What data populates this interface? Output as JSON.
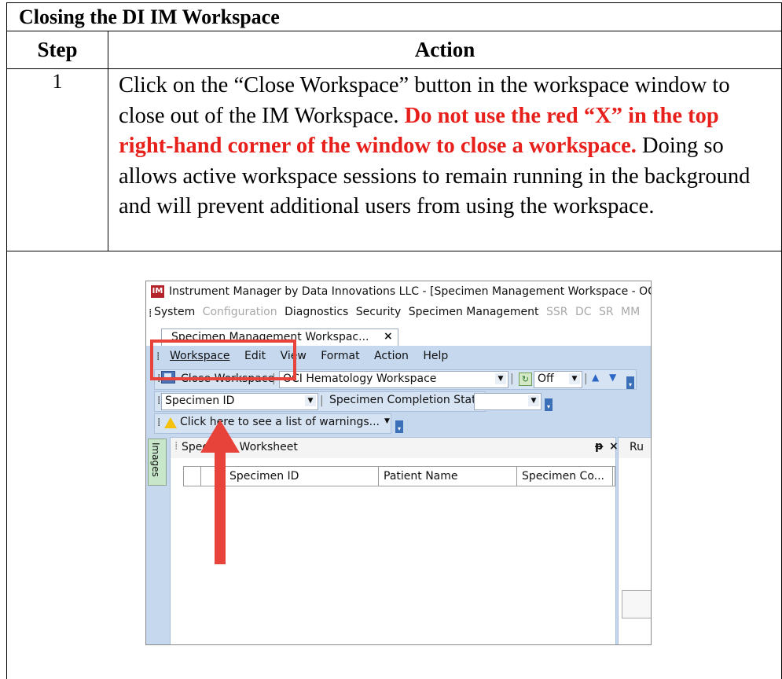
{
  "doc": {
    "title": "Closing the DI IM Workspace",
    "col_step": "Step",
    "col_action": "Action",
    "step_number": "1",
    "instruction_part1": "Click on the “Close Workspace” button in the workspace window to close out of the IM Workspace. ",
    "instruction_warning": "Do not use the red “X” in the top right-hand corner of the window to close a workspace.",
    "instruction_part2": " Doing so allows active workspace sessions to remain running in the background and will prevent additional users from using the workspace."
  },
  "app": {
    "logo": "IM",
    "window_title": "Instrument Manager by Data Innovations LLC - [Specimen Management Workspace - OCI",
    "menu_bar": [
      {
        "label": "System",
        "enabled": true
      },
      {
        "label": "Configuration",
        "enabled": false
      },
      {
        "label": "Diagnostics",
        "enabled": true
      },
      {
        "label": "Security",
        "enabled": true
      },
      {
        "label": "Specimen Management",
        "enabled": true
      },
      {
        "label": "SSR",
        "enabled": false
      },
      {
        "label": "DC",
        "enabled": false
      },
      {
        "label": "SR",
        "enabled": false
      },
      {
        "label": "MM",
        "enabled": false
      }
    ],
    "tab_label": "Specimen Management Workspac...",
    "tab_close": "×",
    "workspace_menu": [
      "Workspace",
      "Edit",
      "View",
      "Format",
      "Action",
      "Help"
    ],
    "close_workspace_label": "Close Workspace",
    "workspace_select": "OCI Hematology Workspace",
    "auto_refresh": "Off",
    "specimen_id_label": "Specimen ID",
    "completion_status_label": "Specimen Completion Status",
    "warnings_text": "Click here to see a list of warnings...",
    "side_tab": "Images",
    "worksheet_title": "Specimen Worksheet",
    "pin_glyph": "ᵽ",
    "close_glyph": "×",
    "columns": [
      "Specimen ID",
      "Patient Name",
      "Specimen Co..."
    ],
    "right_pane_title": "Ru"
  },
  "colors": {
    "warning_red": "#e8201c",
    "annotation_red": "#e8433b",
    "toolbar_blue": "#c5d8ee"
  }
}
